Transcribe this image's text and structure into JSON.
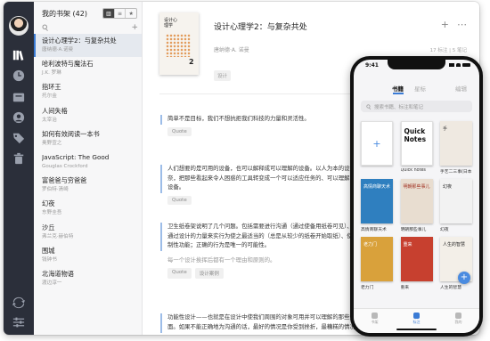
{
  "colors": {
    "accent": "#3a7bd5",
    "rail": "#2b2f3a",
    "list_bg": "#f7f7f8",
    "quote_bar": "#9dbde8"
  },
  "rail": {
    "icons": [
      "books-icon",
      "clock-icon",
      "inbox-icon",
      "user-icon",
      "tag-icon",
      "trash-icon",
      "sync-icon",
      "settings-sliders-icon"
    ]
  },
  "library": {
    "title": "我的书架 (42)",
    "view_toggle": [
      "grid",
      "list",
      "star"
    ],
    "books": [
      {
        "title": "设计心理学2：与复杂共处",
        "author": "唐纳德·A.诺曼"
      },
      {
        "title": "哈利波特与魔法石",
        "author": "J.K. 罗琳"
      },
      {
        "title": "指环王",
        "author": "托尔金"
      },
      {
        "title": "人间失格",
        "author": "太宰治"
      },
      {
        "title": "如何有效阅读一本书",
        "author": "奥野宣之"
      },
      {
        "title": "JavaScript: The Good",
        "author": "Gouglas Crockford"
      },
      {
        "title": "富爸爸与穷爸爸",
        "author": "罗伯特·清崎"
      },
      {
        "title": "幻夜",
        "author": "东野圭吾"
      },
      {
        "title": "沙丘",
        "author": "弗兰克·赫伯特"
      },
      {
        "title": "围城",
        "author": "钱钟书"
      },
      {
        "title": "北海道物语",
        "author": "渡边淳一"
      }
    ]
  },
  "detail": {
    "cover_title": "设计心理学",
    "cover_number": "2",
    "title": "设计心理学2：与复杂共处",
    "author": "唐纳德·A. 诺曼",
    "tag": "设计",
    "meta": "17 标注 | 5 笔记",
    "toolbar": {
      "add": "+",
      "more": "⋯"
    },
    "notes": [
      {
        "text": "简单不是目标，我们不想抗拒我们科技的力量和灵活性。",
        "tags": [
          "Quote"
        ]
      },
      {
        "text": "人们想要的是可用的设备，也可以解释成可以理解的设备。以人为本的设计承诺你",
        "text2": "奈，把那些看起来令人困惑的工具转变成一个可以适应任务的、可以理解的、令人愉悦的",
        "text3": "设备。",
        "tags": [
          "Quote"
        ]
      },
      {
        "text": "卫生纸卷架说明了几个问题。包括需要进行沟通（通过使备用纸卷可见）、",
        "text2": "通过设计的力量来实行为使之最适当的（总是从较少的纸卷开始取纸）、使用可见",
        "text3": "制性功能；正确的行为是唯一的可能性。",
        "sub": "每一个设计挨挥后都有一个理由和原则的。",
        "tags": [
          "Quote",
          "设计案例"
        ]
      },
      {
        "text": "功能性设计——也就是在设计中使我们周围的对象可用并可以理解的那些方",
        "text2": "面。如果不能正确地为沟通的话，最好的情况是你受到挫折，最糟糕的情况则是"
      }
    ]
  },
  "phone": {
    "time": "9:41",
    "tabs": [
      "书籍",
      "星标",
      "编辑"
    ],
    "search_placeholder": "搜索书籍、标注和笔记",
    "books": [
      {
        "label": "",
        "kind": "add"
      },
      {
        "label": "Quick notes",
        "cover_text": "Quick Notes"
      },
      {
        "label": "手艺二三事(日本...",
        "cover_text": "手"
      },
      {
        "label": "高情商聊天术",
        "cover_text": "高情商聊天术"
      },
      {
        "label": "明朝那些事儿",
        "cover_text": "明朝那些事儿"
      },
      {
        "label": "幻夜",
        "cover_text": "幻夜"
      },
      {
        "label": "老力门",
        "cover_text": "老力门"
      },
      {
        "label": "重来",
        "cover_text": "重来"
      },
      {
        "label": "人生的智慧",
        "cover_text": "人生的智慧"
      }
    ],
    "fab": "+",
    "bottom_tabs": [
      "书架",
      "标注",
      "我的"
    ]
  }
}
